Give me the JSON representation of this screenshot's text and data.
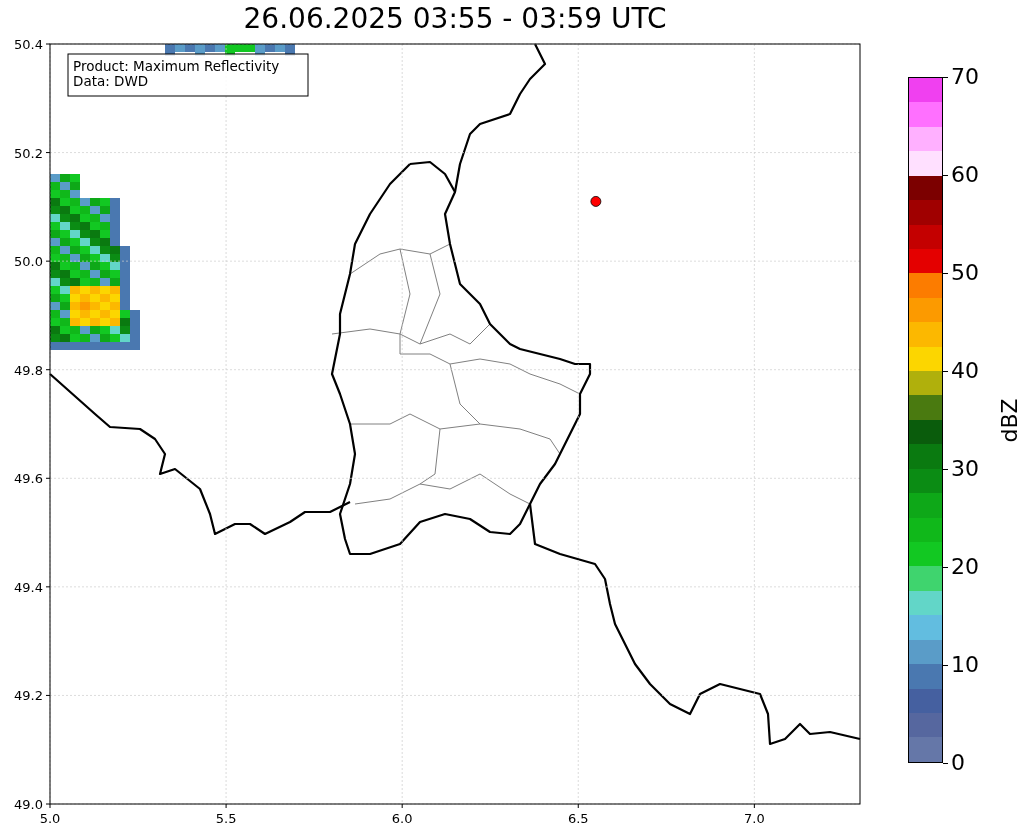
{
  "title": "26.06.2025 03:55 - 03:59 UTC",
  "info_box": [
    "Product: Maximum Reflectivity",
    "Data: DWD"
  ],
  "map": {
    "chart_data": {
      "type": "scatter",
      "grid": true,
      "xlim": [
        5.0,
        7.3
      ],
      "ylim": [
        49.0,
        50.4
      ],
      "x": [
        6.55
      ],
      "values": [
        50.11
      ],
      "xticks": [
        {
          "value": 5.0,
          "label": "5.0"
        },
        {
          "value": 5.5,
          "label": "5.5"
        },
        {
          "value": 6.0,
          "label": "6.0"
        },
        {
          "value": 6.5,
          "label": "6.5"
        },
        {
          "value": 7.0,
          "label": "7.0"
        }
      ],
      "yticks": [
        {
          "value": 49.0,
          "label": "49.0"
        },
        {
          "value": 49.2,
          "label": "49.2"
        },
        {
          "value": 49.4,
          "label": "49.4"
        },
        {
          "value": 49.6,
          "label": "49.6"
        },
        {
          "value": 49.8,
          "label": "49.8"
        },
        {
          "value": 50.0,
          "label": "50.0"
        },
        {
          "value": 50.2,
          "label": "50.2"
        },
        {
          "value": 50.4,
          "label": "50.4"
        }
      ]
    }
  },
  "colorbar": {
    "label": "dBZ",
    "ticks": [
      "70",
      "60",
      "50",
      "40",
      "30",
      "20",
      "10",
      "0"
    ],
    "bins": [
      {
        "color": "#f040f0"
      },
      {
        "color": "#ff70ff"
      },
      {
        "color": "#ffb0ff"
      },
      {
        "color": "#ffe0ff"
      },
      {
        "color": "#7c0000"
      },
      {
        "color": "#a00000"
      },
      {
        "color": "#c40000"
      },
      {
        "color": "#e40000"
      },
      {
        "color": "#fc7c00"
      },
      {
        "color": "#fc9a00"
      },
      {
        "color": "#fcb800"
      },
      {
        "color": "#fcd600"
      },
      {
        "color": "#b0b00c"
      },
      {
        "color": "#4a7a10"
      },
      {
        "color": "#0a5c0c"
      },
      {
        "color": "#0a7a10"
      },
      {
        "color": "#0b8c14"
      },
      {
        "color": "#0ea818"
      },
      {
        "color": "#10b81a"
      },
      {
        "color": "#12c822"
      },
      {
        "color": "#3fd46e"
      },
      {
        "color": "#62d6c8"
      },
      {
        "color": "#62bde0"
      },
      {
        "color": "#5a9cc8"
      },
      {
        "color": "#4a78b0"
      },
      {
        "color": "#4560a0"
      },
      {
        "color": "#56679f"
      },
      {
        "color": "#6577a8"
      }
    ]
  }
}
